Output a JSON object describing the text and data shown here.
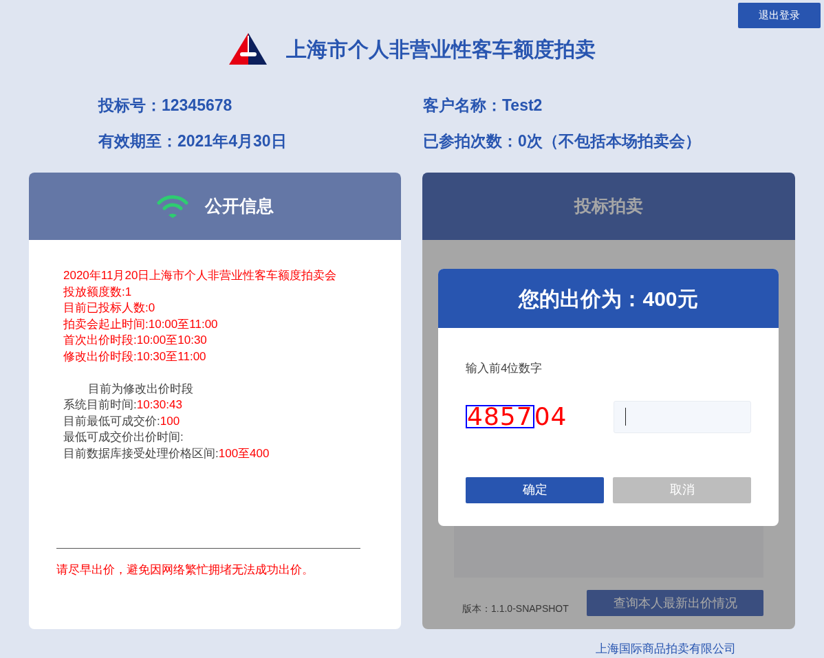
{
  "logout_button": "退出登录",
  "title": "上海市个人非营业性客车额度拍卖",
  "account": [
    {
      "label": "投标号：",
      "value": "12345678"
    },
    {
      "label": "客户名称：",
      "value": "Test2"
    },
    {
      "label": "有效期至：",
      "value": "2021年4月30日"
    },
    {
      "label": "已参拍次数：",
      "value": "0次（不包括本场拍卖会）"
    }
  ],
  "public_info": {
    "title": "公开信息",
    "announcement": [
      "2020年11月20日上海市个人非营业性客车额度拍卖会",
      "投放额度数:1",
      "目前已投标人数:0",
      "拍卖会起止时间:10:00至11:00",
      "首次出价时段:10:00至10:30",
      "修改出价时段:10:30至11:00"
    ],
    "status": "目前为修改出价时段",
    "readings": [
      {
        "label": "系统目前时间:",
        "value": "10:30:43"
      },
      {
        "label": "目前最低可成交价:",
        "value": "100"
      },
      {
        "label": "最低可成交价出价时间:"
      },
      {
        "label": "目前数据库接受处理价格区间:",
        "value": "100至400"
      }
    ],
    "warning": "请尽早出价，避免因网络繁忙拥堵无法成功出价。"
  },
  "bidding": {
    "title": "投标拍卖",
    "version": "版本：1.1.0-SNAPSHOT",
    "query_button": "查询本人最新出价情况"
  },
  "dialog": {
    "title": "您的出价为：400元",
    "prompt": "输入前4位数字",
    "captcha": {
      "highlighted": "4857",
      "rest": "04"
    },
    "buttons": [
      {
        "label": "确定",
        "kind": "primary"
      },
      {
        "label": "取消",
        "kind": "secondary"
      }
    ]
  },
  "footer": "上海国际商品拍卖有限公司"
}
